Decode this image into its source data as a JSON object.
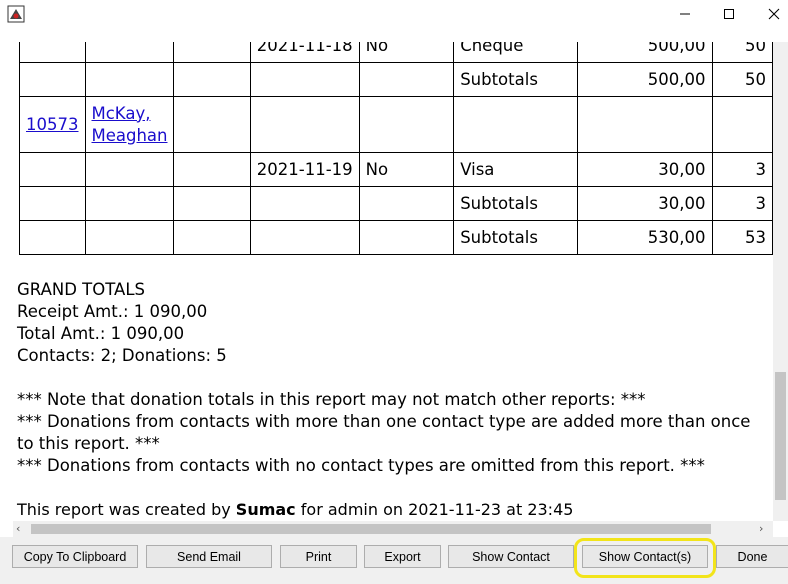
{
  "window": {
    "icon": "java-app-icon",
    "controls": [
      "minimize-icon",
      "maximize-icon",
      "close-icon"
    ]
  },
  "table": {
    "rows": [
      {
        "date": "2021-11-18",
        "flag": "No",
        "method": "Cheque",
        "amount": "500,00",
        "amount2": "50"
      },
      {
        "method": "Subtotals",
        "amount": "500,00",
        "amount2": "50"
      },
      {
        "contact_id": "10573",
        "contact_name": "McKay, Meaghan"
      },
      {
        "date": "2021-11-19",
        "flag": "No",
        "method": "Visa",
        "amount": "30,00",
        "amount2": "3"
      },
      {
        "method": "Subtotals",
        "amount": "30,00",
        "amount2": "3"
      },
      {
        "method": "Subtotals",
        "amount": "530,00",
        "amount2": "53"
      }
    ]
  },
  "grand_totals": {
    "heading": "GRAND TOTALS",
    "receipt": "Receipt Amt.: 1 090,00",
    "total": "Total Amt.: 1 090,00",
    "counts": "Contacts: 2; Donations: 5"
  },
  "notes": {
    "line1": "*** Note that donation totals in this report may not match other reports: ***",
    "line2": "*** Donations from contacts with more than one contact type are added more than once to this report. ***",
    "line3": "*** Donations from contacts with no contact types are omitted from this report. ***"
  },
  "footer": {
    "prefix": "This report was created by",
    "app": "Sumac",
    "suffix": "for admin on 2021-11-23 at 23:45"
  },
  "buttons": {
    "copy": "Copy To Clipboard",
    "email": "Send Email",
    "print": "Print",
    "export": "Export",
    "show_contact": "Show Contact",
    "show_contacts": "Show Contact(s)",
    "done": "Done"
  },
  "colors": {
    "link": "#1a0dcc",
    "highlight": "#f2e41a"
  }
}
